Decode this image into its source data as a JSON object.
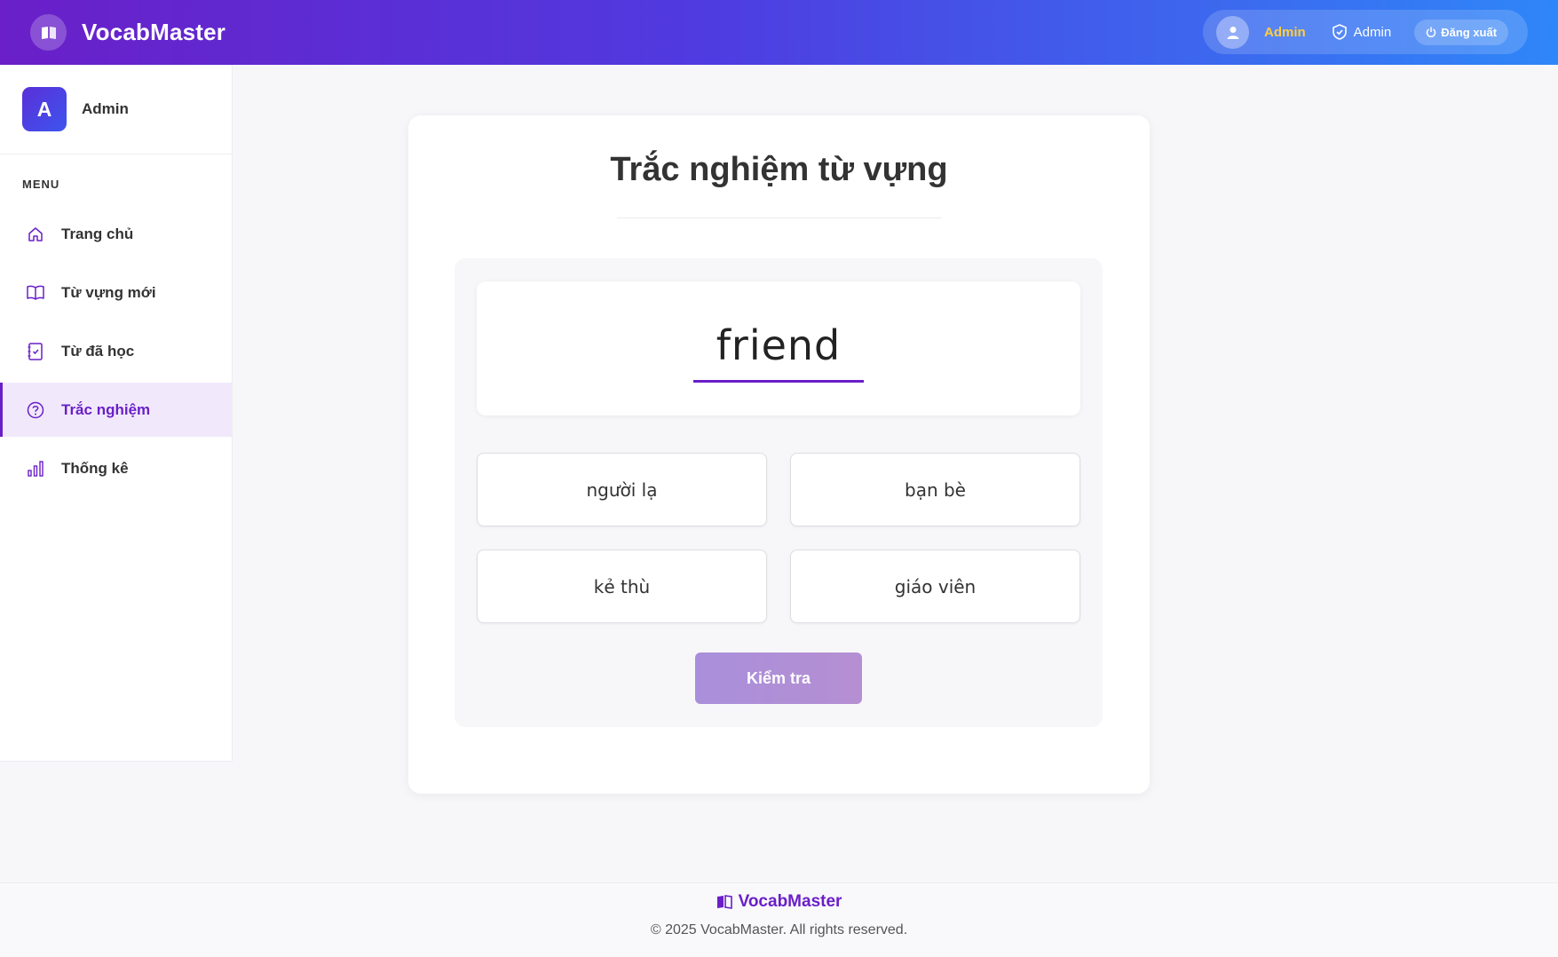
{
  "app": {
    "title": "VocabMaster"
  },
  "header": {
    "user_name": "Admin",
    "role": "Admin",
    "logout_label": "Đăng xuất"
  },
  "sidebar": {
    "user_initial": "A",
    "user_name": "Admin",
    "menu_title": "MENU",
    "items": [
      {
        "label": "Trang chủ",
        "icon": "home-icon"
      },
      {
        "label": "Từ vựng mới",
        "icon": "book-icon"
      },
      {
        "label": "Từ đã học",
        "icon": "checklist-icon"
      },
      {
        "label": "Trắc nghiệm",
        "icon": "question-icon",
        "active": true
      },
      {
        "label": "Thống kê",
        "icon": "bar-chart-icon"
      }
    ]
  },
  "quiz": {
    "title": "Trắc nghiệm từ vựng",
    "word": "friend",
    "options": [
      "người lạ",
      "bạn bè",
      "kẻ thù",
      "giáo viên"
    ],
    "check_label": "Kiểm tra"
  },
  "footer": {
    "brand": "VocabMaster",
    "copyright": "© 2025 VocabMaster. All rights reserved."
  },
  "colors": {
    "primary": "#6a1fc8",
    "header_start": "#6a1fc8",
    "header_end": "#2f86f8",
    "highlight": "#ffcf3d"
  }
}
